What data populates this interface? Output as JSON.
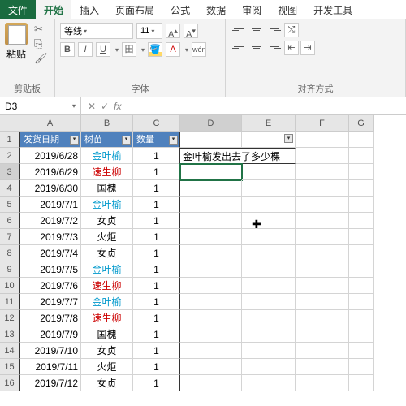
{
  "tabs": {
    "file": "文件",
    "home": "开始",
    "insert": "插入",
    "layout": "页面布局",
    "formula": "公式",
    "data": "数据",
    "review": "审阅",
    "view": "视图",
    "dev": "开发工具"
  },
  "ribbon": {
    "clipboard": {
      "paste": "粘贴",
      "label": "剪贴板"
    },
    "font": {
      "name": "等线",
      "size": "11",
      "label": "字体",
      "bold": "B",
      "italic": "I",
      "underline": "U",
      "wen": "wén"
    },
    "align": {
      "label": "对齐方式"
    }
  },
  "namebox": "D3",
  "fx": "fx",
  "cols": [
    "A",
    "B",
    "C",
    "D",
    "E",
    "F",
    "G"
  ],
  "headers": {
    "a": "发货日期",
    "b": "树苗",
    "c": "数量"
  },
  "question": "金叶榆发出去了多少棵",
  "rows": [
    {
      "n": 2,
      "a": "2019/6/28",
      "b": "金叶榆",
      "c": "1",
      "bc": "cyan"
    },
    {
      "n": 3,
      "a": "2019/6/29",
      "b": "速生柳",
      "c": "1",
      "bc": "red"
    },
    {
      "n": 4,
      "a": "2019/6/30",
      "b": "国槐",
      "c": "1",
      "bc": ""
    },
    {
      "n": 5,
      "a": "2019/7/1",
      "b": "金叶榆",
      "c": "1",
      "bc": "cyan"
    },
    {
      "n": 6,
      "a": "2019/7/2",
      "b": "女贞",
      "c": "1",
      "bc": ""
    },
    {
      "n": 7,
      "a": "2019/7/3",
      "b": "火炬",
      "c": "1",
      "bc": ""
    },
    {
      "n": 8,
      "a": "2019/7/4",
      "b": "女贞",
      "c": "1",
      "bc": ""
    },
    {
      "n": 9,
      "a": "2019/7/5",
      "b": "金叶榆",
      "c": "1",
      "bc": "cyan"
    },
    {
      "n": 10,
      "a": "2019/7/6",
      "b": "速生柳",
      "c": "1",
      "bc": "red"
    },
    {
      "n": 11,
      "a": "2019/7/7",
      "b": "金叶榆",
      "c": "1",
      "bc": "cyan"
    },
    {
      "n": 12,
      "a": "2019/7/8",
      "b": "速生柳",
      "c": "1",
      "bc": "red"
    },
    {
      "n": 13,
      "a": "2019/7/9",
      "b": "国槐",
      "c": "1",
      "bc": ""
    },
    {
      "n": 14,
      "a": "2019/7/10",
      "b": "女贞",
      "c": "1",
      "bc": ""
    },
    {
      "n": 15,
      "a": "2019/7/11",
      "b": "火炬",
      "c": "1",
      "bc": ""
    },
    {
      "n": 16,
      "a": "2019/7/12",
      "b": "女贞",
      "c": "1",
      "bc": ""
    }
  ]
}
